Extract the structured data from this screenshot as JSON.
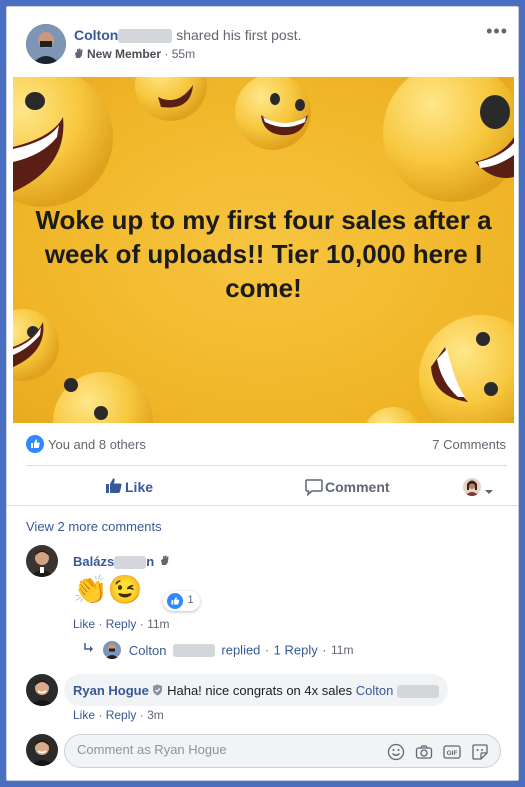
{
  "post": {
    "author": "Colton",
    "shared_text": "shared his first post.",
    "badge": "New Member",
    "time": "55m",
    "menu_icon": "•••"
  },
  "image_text": "Woke up to my first four sales after a week of uploads!! Tier 10,000 here I come!",
  "reactions": {
    "summary": "You and 8 others",
    "comments_count": "7 Comments"
  },
  "actions": {
    "like_label": "Like",
    "comment_label": "Comment"
  },
  "view_more": "View 2 more comments",
  "comments": [
    {
      "author": "Balázs",
      "author_tail": "n",
      "emojis": "👏😉",
      "reaction_count": "1",
      "like": "Like",
      "reply": "Reply",
      "time": "11m",
      "reply_thread": {
        "author": "Colton",
        "text": "replied",
        "sep": "·",
        "count": "1 Reply",
        "time": "11m"
      }
    },
    {
      "author": "Ryan Hogue",
      "text": "Haha! nice congrats on 4x sales",
      "mention": "Colton",
      "like": "Like",
      "reply": "Reply",
      "time": "3m"
    }
  ],
  "composer": {
    "placeholder": "Comment as Ryan Hogue"
  },
  "colors": {
    "link_blue": "#385898",
    "like_blue": "#2e89ff",
    "image_yellow": "#f0b527"
  }
}
